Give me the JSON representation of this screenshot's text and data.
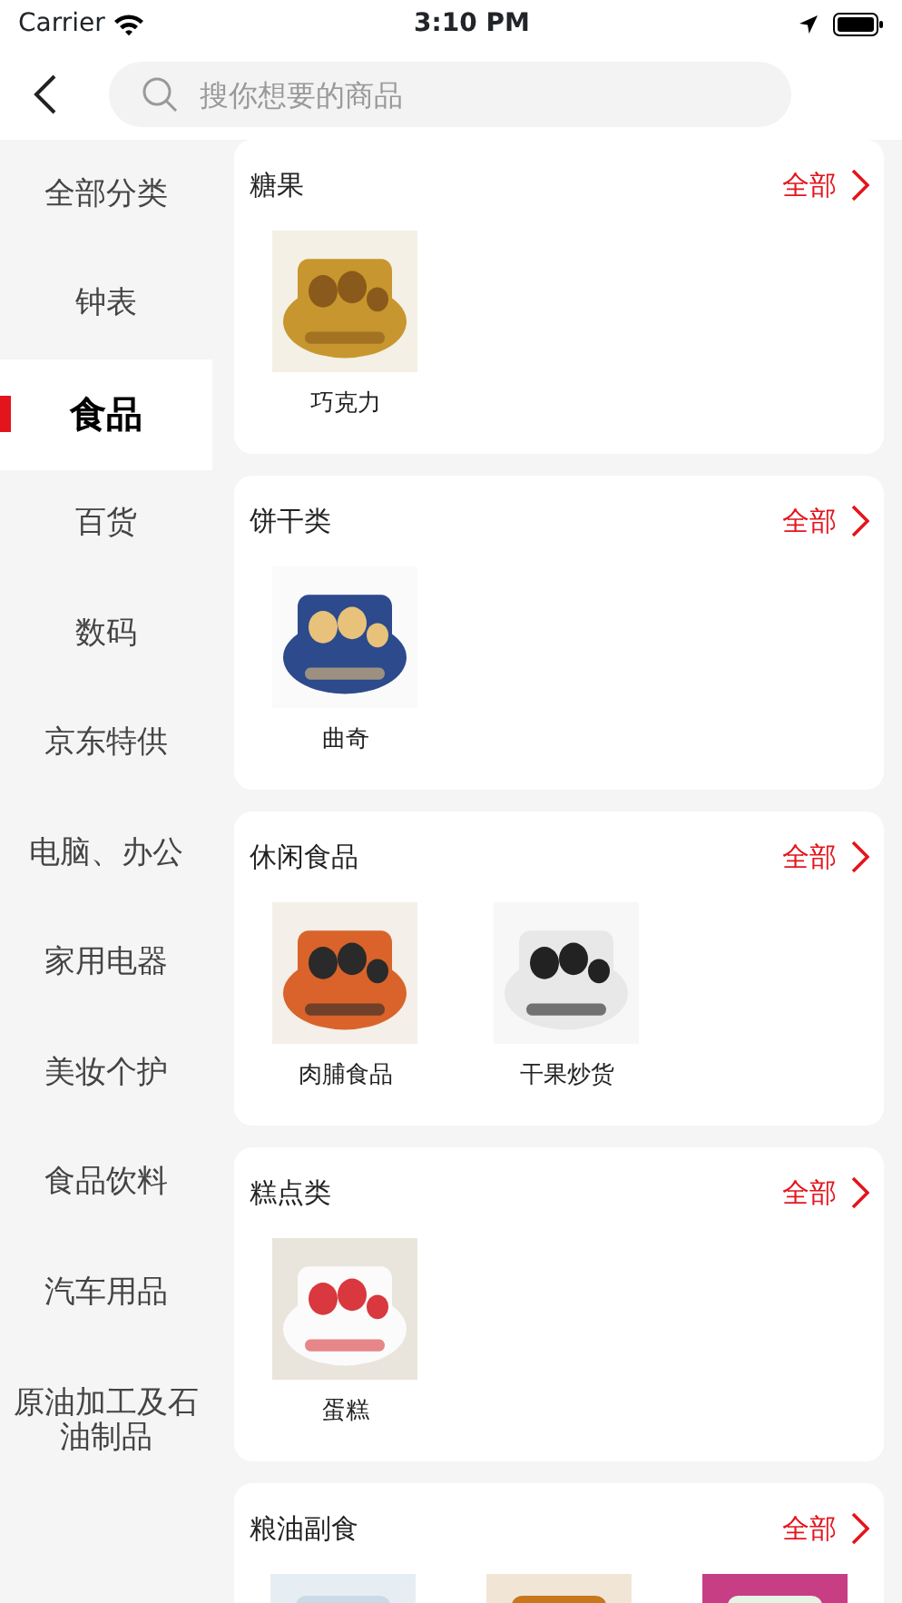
{
  "status_bar": {
    "carrier": "Carrier",
    "time": "3:10 PM"
  },
  "search": {
    "placeholder": "搜你想要的商品"
  },
  "categories": [
    {
      "label": "全部分类",
      "selected": false
    },
    {
      "label": "钟表",
      "selected": false
    },
    {
      "label": "食品",
      "selected": true
    },
    {
      "label": "百货",
      "selected": false
    },
    {
      "label": "数码",
      "selected": false
    },
    {
      "label": "京东特供",
      "selected": false
    },
    {
      "label": "电脑、办公",
      "selected": false
    },
    {
      "label": "家用电器",
      "selected": false
    },
    {
      "label": "美妆个护",
      "selected": false
    },
    {
      "label": "食品饮料",
      "selected": false
    },
    {
      "label": "汽车用品",
      "selected": false
    },
    {
      "label": "原油加工及石油制品",
      "selected": false
    }
  ],
  "sections": [
    {
      "title": "糖果",
      "more": "全部",
      "products": [
        {
          "name": "巧克力"
        }
      ]
    },
    {
      "title": "饼干类",
      "more": "全部",
      "products": [
        {
          "name": "曲奇"
        }
      ]
    },
    {
      "title": "休闲食品",
      "more": "全部",
      "products": [
        {
          "name": "肉脯食品"
        },
        {
          "name": "干果炒货"
        }
      ]
    },
    {
      "title": "糕点类",
      "more": "全部",
      "products": [
        {
          "name": "蛋糕"
        }
      ]
    },
    {
      "title": "粮油副食",
      "more": "全部"
    }
  ]
}
